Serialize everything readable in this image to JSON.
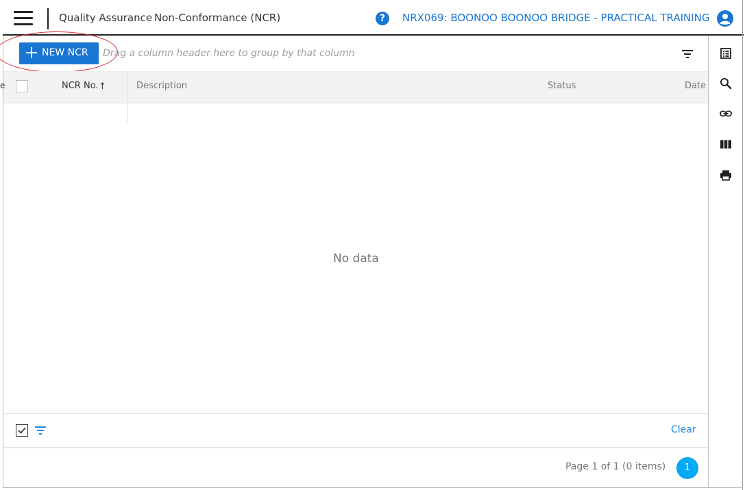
{
  "header": {
    "module": "Quality Assurance",
    "page": "Non-Conformance (NCR)",
    "project": "NRX069: BOONOO BOONOO BRIDGE - PRACTICAL TRAINING",
    "help_glyph": "?",
    "icons": [
      "menu-icon",
      "help-icon",
      "user-account-icon"
    ]
  },
  "toolbar": {
    "new_button": "NEW NCR",
    "group_panel_hint": "Drag a column header here to group by that column",
    "filter_icon": "filter-list-icon"
  },
  "grid": {
    "columns": [
      "NCR No.",
      "Description",
      "Status",
      "Date"
    ],
    "sort": {
      "column": "NCR No.",
      "direction": "ascending",
      "glyph": "↑"
    },
    "rows": [],
    "empty_text": "No data"
  },
  "filter_footer": {
    "clear_label": "Clear"
  },
  "pager": {
    "info": "Page 1 of 1 (0 items)",
    "current_page": "1"
  },
  "side_toolbar": {
    "icons": [
      "list-view-icon",
      "search-icon",
      "link-icon",
      "columns-icon",
      "print-icon"
    ]
  },
  "colors": {
    "accent": "#1976d2",
    "page_active": "#03a9f4",
    "highlight_ring": "#e02020"
  }
}
